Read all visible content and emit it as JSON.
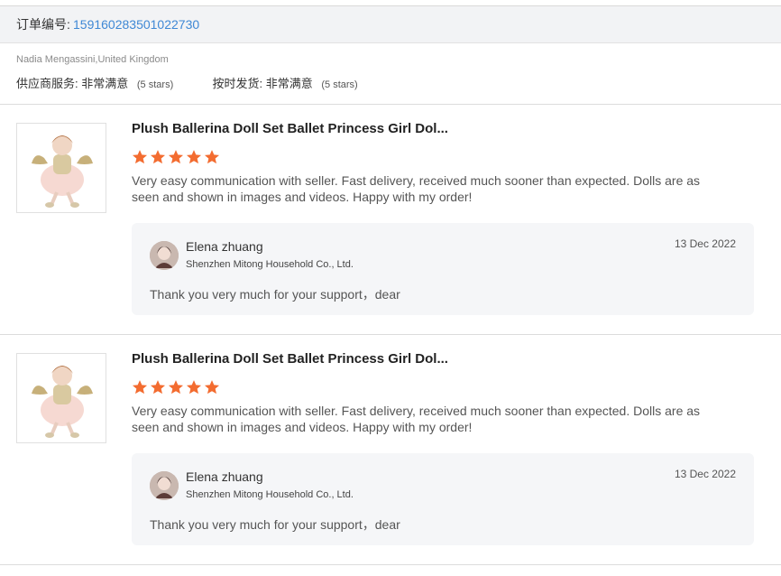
{
  "order": {
    "label": "订单编号:",
    "number": "159160283501022730"
  },
  "buyer": "Nadia Mengassini,United Kingdom",
  "ratings": {
    "supplier_label": "供应商服务:",
    "supplier_value": "非常满意",
    "supplier_stars": "(5 stars)",
    "delivery_label": "按时发货:",
    "delivery_value": "非常满意",
    "delivery_stars": "(5 stars)"
  },
  "colors": {
    "star": "#f36c30",
    "link": "#3f88d5"
  },
  "reviews": [
    {
      "product_title": "Plush Ballerina Doll Set Ballet Princess Girl Dol...",
      "stars": 5,
      "comment": "Very easy communication with seller. Fast delivery, received much sooner than expected.  Dolls are as seen and shown in images and videos. Happy with my order!",
      "reply": {
        "seller_name": "Elena zhuang",
        "company": "Shenzhen Mitong Household Co., Ltd.",
        "date": "13 Dec 2022",
        "text": "Thank you very much for your support，dear"
      }
    },
    {
      "product_title": "Plush Ballerina Doll Set Ballet Princess Girl Dol...",
      "stars": 5,
      "comment": "Very easy communication with seller. Fast delivery, received much sooner than expected.  Dolls are as seen and shown in images and videos. Happy with my order!",
      "reply": {
        "seller_name": "Elena zhuang",
        "company": "Shenzhen Mitong Household Co., Ltd.",
        "date": "13 Dec 2022",
        "text": "Thank you very much for your support，dear"
      }
    }
  ]
}
